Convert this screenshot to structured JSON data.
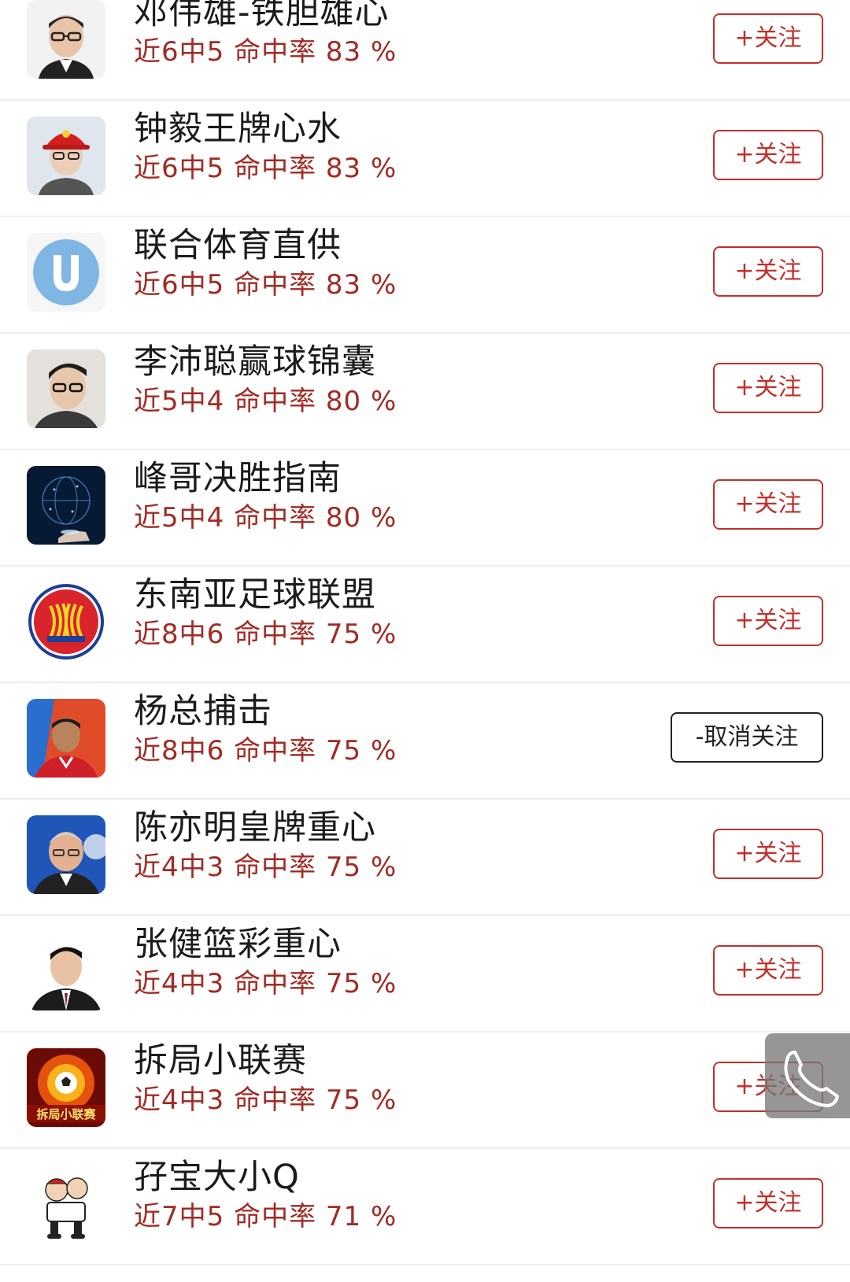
{
  "colors": {
    "accent": "#c0302b",
    "stat_text": "#a12b24",
    "name_text": "#1b1b1b",
    "divider": "#eeeeee"
  },
  "rows": [
    {
      "name": "邓伟雄-铁胆雄心",
      "stat": "近6中5 命中率 83 %",
      "button": "+关注",
      "avatar_icon": "man-glasses-avatar"
    },
    {
      "name": "钟毅王牌心水",
      "stat": "近6中5 命中率 83 %",
      "button": "+关注",
      "avatar_icon": "man-red-cap-avatar"
    },
    {
      "name": "联合体育直供",
      "stat": "近6中5 命中率 83 %",
      "button": "+关注",
      "avatar_icon": "u-logo-avatar"
    },
    {
      "name": "李沛聪赢球锦囊",
      "stat": "近5中4 命中率 80 %",
      "button": "+关注",
      "avatar_icon": "man-glasses-avatar"
    },
    {
      "name": "峰哥决胜指南",
      "stat": "近5中4 命中率 80 %",
      "button": "+关注",
      "avatar_icon": "digital-globe-avatar"
    },
    {
      "name": "东南亚足球联盟",
      "stat": "近8中6 命中率 75 %",
      "button": "+关注",
      "avatar_icon": "asean-emblem-avatar"
    },
    {
      "name": "杨总捕击",
      "stat": "近8中6 命中率 75 %",
      "button": "-取消关注",
      "avatar_icon": "man-red-jersey-avatar"
    },
    {
      "name": "陈亦明皇牌重心",
      "stat": "近4中3 命中率 75 %",
      "button": "+关注",
      "avatar_icon": "older-man-avatar"
    },
    {
      "name": "张健篮彩重心",
      "stat": "近4中3 命中率 75 %",
      "button": "+关注",
      "avatar_icon": "man-suit-avatar"
    },
    {
      "name": "拆局小联赛",
      "stat": "近4中3 命中率 75 %",
      "button": "+关注",
      "avatar_icon": "fire-football-avatar",
      "avatar_text": "拆局小联赛"
    },
    {
      "name": "孖宝大小Q",
      "stat": "近7中5 命中率 71 %",
      "button": "+关注",
      "avatar_icon": "cartoon-mascot-avatar"
    }
  ],
  "floating_button": {
    "icon": "phone-icon"
  }
}
